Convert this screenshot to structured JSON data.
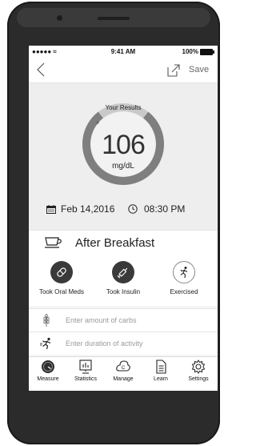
{
  "status_bar": {
    "carrier": "●●●●● ≈",
    "time": "9:41 AM",
    "battery": "100%"
  },
  "nav": {
    "save_label": "Save"
  },
  "results": {
    "label": "Your Results",
    "value": "106",
    "unit": "mg/dL"
  },
  "datetime": {
    "date": "Feb 14,2016",
    "time": "08:30 PM"
  },
  "meal": {
    "label": "After Breakfast"
  },
  "actions": [
    {
      "label": "Took Oral Meds",
      "icon": "pill-icon"
    },
    {
      "label": "Took Insulin",
      "icon": "syringe-icon"
    },
    {
      "label": "Exercised",
      "icon": "runner-icon"
    }
  ],
  "inputs": {
    "carbs_placeholder": "Enter amount of carbs",
    "activity_placeholder": "Enter duration of activity"
  },
  "tabs": [
    {
      "label": "Measure",
      "icon": "measure-icon"
    },
    {
      "label": "Statistics",
      "icon": "statistics-icon"
    },
    {
      "label": "Manage",
      "icon": "manage-icon"
    },
    {
      "label": "Learn",
      "icon": "learn-icon"
    },
    {
      "label": "Settings",
      "icon": "settings-icon"
    }
  ]
}
